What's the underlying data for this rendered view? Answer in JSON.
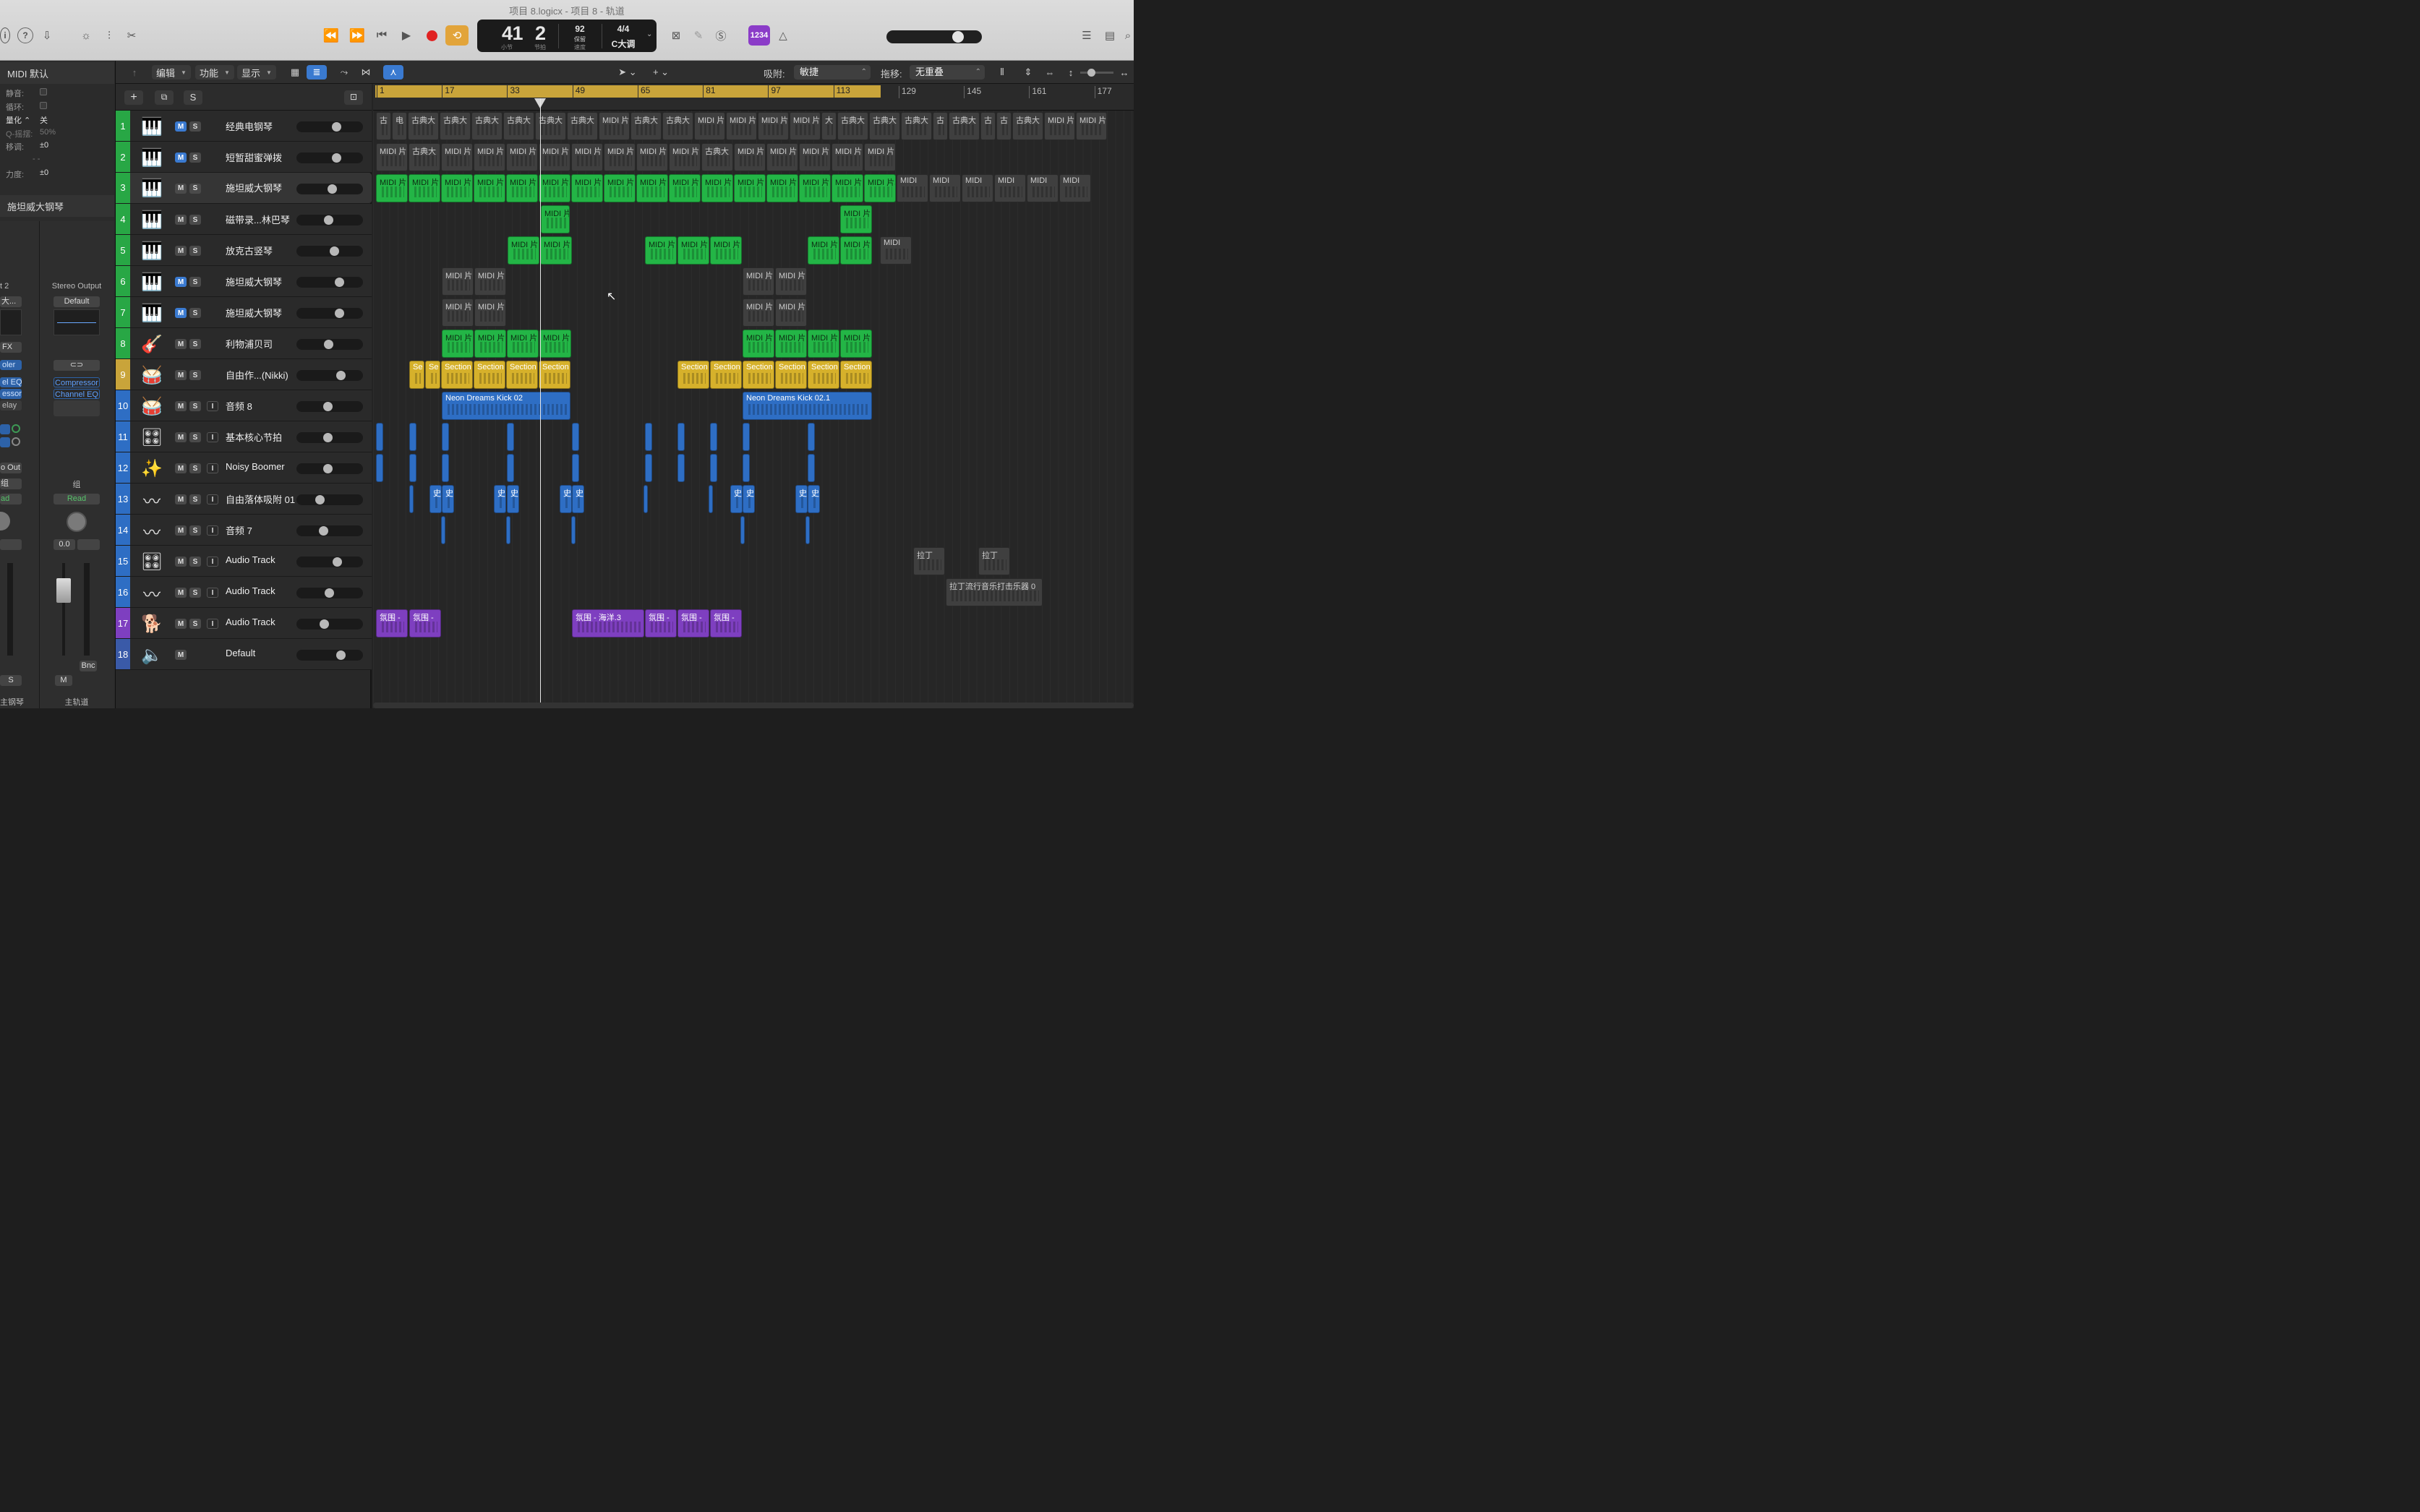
{
  "window": {
    "title": "项目 8.logicx - 项目 8 - 轨道"
  },
  "lcd": {
    "bar": "41",
    "beat": "2",
    "bar_label": "小节",
    "beat_label": "节拍",
    "tempo": "92",
    "tempo_mode": "保留",
    "tempo_label": "速度",
    "signature": "4/4",
    "key": "C大调"
  },
  "count_in": "1234",
  "inspector": {
    "region_header": "MIDI 默认",
    "mute_label": "静音:",
    "loop_label": "循环:",
    "quantize_label": "量化",
    "quantize_value": "关",
    "q_swing_label": "Q-摇摆:",
    "q_swing_value": "50%",
    "transpose_label": "移调:",
    "transpose_value": "±0",
    "dash": "- -",
    "velocity_label": "力度:",
    "velocity_value": "±0",
    "track_header": "施坦威大钢琴",
    "left_strip": {
      "io": "t 2",
      "inst": "大...",
      "fx": "FX",
      "plugins": [
        "oler",
        "el EQ",
        "essor",
        "elay"
      ],
      "out": "o Out",
      "group": "组",
      "read": "ad",
      "mute": "S",
      "name": "主钢琴"
    },
    "right_strip": {
      "output": "Stereo Output",
      "setting": "Default",
      "plugins": [
        "Compressor",
        "Channel EQ"
      ],
      "group": "组",
      "read": "Read",
      "pan_value": "0.0",
      "mute": "M",
      "bounce": "Bnc",
      "name": "主轨道"
    }
  },
  "toolbar": {
    "edit": "编辑",
    "function": "功能",
    "view": "显示",
    "snap_label": "吸附:",
    "snap_value": "敏捷",
    "drag_label": "拖移:",
    "drag_value": "无重叠"
  },
  "ruler": [
    "1",
    "17",
    "33",
    "49",
    "65",
    "81",
    "97",
    "113",
    "129",
    "145",
    "161",
    "177"
  ],
  "tracks": [
    {
      "num": "1",
      "name": "经典电钢琴",
      "icon": "electric-piano",
      "m_on": true,
      "has_i": false,
      "fader": 0.62,
      "color": "#28a745"
    },
    {
      "num": "2",
      "name": "短暂甜蜜弹拨",
      "icon": "synth-keyboard",
      "m_on": true,
      "has_i": false,
      "fader": 0.62,
      "color": "#28a745"
    },
    {
      "num": "3",
      "name": "施坦威大钢琴",
      "icon": "grand-piano",
      "m_on": false,
      "has_i": false,
      "fader": 0.55,
      "color": "#28a745"
    },
    {
      "num": "4",
      "name": "磁带录...林巴琴",
      "icon": "upright-piano",
      "m_on": false,
      "has_i": false,
      "fader": 0.48,
      "color": "#28a745"
    },
    {
      "num": "5",
      "name": "放克古竖琴",
      "icon": "keyboard-stand",
      "m_on": false,
      "has_i": false,
      "fader": 0.58,
      "color": "#28a745"
    },
    {
      "num": "6",
      "name": "施坦威大钢琴",
      "icon": "grand-piano",
      "m_on": true,
      "has_i": false,
      "fader": 0.67,
      "color": "#28a745"
    },
    {
      "num": "7",
      "name": "施坦威大钢琴",
      "icon": "grand-piano",
      "m_on": true,
      "has_i": false,
      "fader": 0.67,
      "color": "#28a745"
    },
    {
      "num": "8",
      "name": "利物浦贝司",
      "icon": "bass-guitar",
      "m_on": false,
      "has_i": false,
      "fader": 0.48,
      "color": "#28a745"
    },
    {
      "num": "9",
      "name": "自由作...(Nikki)",
      "icon": "drum-kit",
      "m_on": false,
      "has_i": false,
      "fader": 0.7,
      "color": "#c9a43a"
    },
    {
      "num": "10",
      "name": "音频 8",
      "icon": "snare-drum",
      "m_on": false,
      "has_i": true,
      "fader": 0.47,
      "color": "#2e6ec4"
    },
    {
      "num": "11",
      "name": "基本核心节拍",
      "icon": "drum-machine",
      "m_on": false,
      "has_i": true,
      "fader": 0.47,
      "color": "#2e6ec4"
    },
    {
      "num": "12",
      "name": "Noisy Boomer",
      "icon": "sparkle",
      "m_on": false,
      "has_i": true,
      "fader": 0.47,
      "color": "#2e6ec4"
    },
    {
      "num": "13",
      "name": "自由落体吸附 01",
      "icon": "audio-waveform",
      "m_on": false,
      "has_i": true,
      "fader": 0.33,
      "color": "#2e6ec4"
    },
    {
      "num": "14",
      "name": "音频 7",
      "icon": "audio-waveform",
      "m_on": false,
      "has_i": true,
      "fader": 0.39,
      "color": "#2e6ec4"
    },
    {
      "num": "15",
      "name": "Audio Track",
      "icon": "drum-machine",
      "m_on": false,
      "has_i": true,
      "fader": 0.63,
      "color": "#2e6ec4"
    },
    {
      "num": "16",
      "name": "Audio Track",
      "icon": "audio-waveform",
      "m_on": false,
      "has_i": true,
      "fader": 0.49,
      "color": "#2e6ec4"
    },
    {
      "num": "17",
      "name": "Audio Track",
      "icon": "dog",
      "m_on": false,
      "has_i": true,
      "fader": 0.4,
      "color": "#7e3fc0"
    },
    {
      "num": "18",
      "name": "Default",
      "icon": "speaker",
      "m_on": false,
      "has_i": false,
      "fader": 0.7,
      "color": "#3a5aa8"
    }
  ],
  "regions": {
    "row1": [
      [
        "古",
        "grey"
      ],
      [
        "电",
        "grey"
      ],
      [
        "古典大",
        "grey"
      ],
      [
        "古典大",
        "grey"
      ],
      [
        "古典大",
        "grey"
      ],
      [
        "古典大",
        "grey"
      ],
      [
        "古典大",
        "grey"
      ],
      [
        "古典大",
        "grey"
      ],
      [
        "MIDI 片",
        "grey"
      ],
      [
        "古典大",
        "grey"
      ],
      [
        "古典大",
        "grey"
      ],
      [
        "MIDI 片",
        "grey"
      ],
      [
        "MIDI 片",
        "grey"
      ],
      [
        "MIDI 片",
        "grey"
      ],
      [
        "MIDI 片",
        "grey"
      ],
      [
        "大",
        "grey"
      ],
      [
        "古典大",
        "grey"
      ],
      [
        "古典大",
        "grey"
      ],
      [
        "古典大",
        "grey"
      ],
      [
        "古",
        "grey"
      ],
      [
        "古典大",
        "grey"
      ],
      [
        "古",
        "grey"
      ],
      [
        "古",
        "grey"
      ],
      [
        "古典大",
        "grey"
      ],
      [
        "MIDI 片",
        "grey"
      ],
      [
        "MIDI 片",
        "grey"
      ]
    ],
    "row2": [
      "MIDI 片",
      "古典大",
      "MIDI 片",
      "MIDI 片",
      "MIDI 片",
      "MIDI 片",
      "MIDI 片",
      "MIDI 片",
      "MIDI 片",
      "MIDI 片",
      "古典大",
      "MIDI 片",
      "MIDI 片",
      "MIDI 片",
      "MIDI 片",
      "MIDI 片"
    ],
    "row3_green": [
      "MIDI 片",
      "MIDI 片",
      "MIDI 片",
      "MIDI 片",
      "MIDI 片",
      "MIDI 片段",
      "MIDI 片",
      "MIDI 片",
      "MIDI 片",
      "MIDI 片",
      "MIDI 片",
      "MIDI 片",
      "MIDI 片",
      "MIDI 片",
      "MIDI 片",
      "MIDI 片段"
    ],
    "row3_grey": [
      "MIDI",
      "MIDI",
      "MIDI",
      "MIDI",
      "MIDI",
      "MIDI"
    ],
    "midi_clip": "MIDI 片",
    "midi_short": "MIDI",
    "section": "Section",
    "section_short": "Se",
    "kick_a": "Neon Dreams Kick 02",
    "kick_b": "Neon Dreams Kick 02.1",
    "shi": "史",
    "latin": "拉丁",
    "latin_long": "拉丁流行音乐打击乐器 0",
    "ambience": "氛围 -",
    "ocean": "氛围 - 海洋.3"
  }
}
